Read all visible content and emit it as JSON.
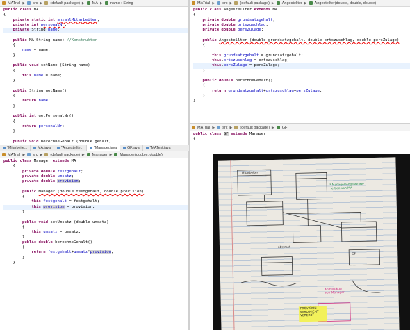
{
  "editor_top_left": {
    "breadcrumb": [
      "MATrial",
      "src",
      "(default package)",
      "MA",
      "name : String"
    ],
    "lines": [
      [
        {
          "t": "public class MA",
          "c": "kwline"
        }
      ],
      [
        {
          "t": "{",
          "c": ""
        }
      ],
      [
        {
          "t": "    "
        },
        {
          "t": "private static int",
          "c": "kw"
        },
        {
          "t": " "
        },
        {
          "t": "anzahlMitarbeiter",
          "c": "fld err"
        },
        {
          "t": ";"
        }
      ],
      [
        {
          "t": "    "
        },
        {
          "t": "private int",
          "c": "kw"
        },
        {
          "t": " "
        },
        {
          "t": "personalNr",
          "c": "fld err"
        },
        {
          "t": ";"
        }
      ],
      [
        {
          "t": "    "
        },
        {
          "t": "private",
          "c": "kw"
        },
        {
          "t": " String "
        },
        {
          "t": "name",
          "c": "fld"
        },
        {
          "t": ";"
        }
      ],
      [
        {
          "t": ""
        }
      ],
      [
        {
          "t": "    "
        },
        {
          "t": "public",
          "c": "kw"
        },
        {
          "t": " MA(String name) "
        },
        {
          "t": "//Konstruktor",
          "c": "cm"
        }
      ],
      [
        {
          "t": "    {"
        }
      ],
      [
        {
          "t": "        "
        },
        {
          "t": "name",
          "c": "fld"
        },
        {
          "t": " = name;"
        }
      ],
      [
        {
          "t": "    }"
        }
      ],
      [
        {
          "t": ""
        }
      ],
      [
        {
          "t": "    "
        },
        {
          "t": "public void",
          "c": "kw"
        },
        {
          "t": " setName (String name)"
        }
      ],
      [
        {
          "t": "    {"
        }
      ],
      [
        {
          "t": "        "
        },
        {
          "t": "this",
          "c": "kw"
        },
        {
          "t": "."
        },
        {
          "t": "name",
          "c": "fld"
        },
        {
          "t": " = name;"
        }
      ],
      [
        {
          "t": "    }"
        }
      ],
      [
        {
          "t": ""
        }
      ],
      [
        {
          "t": "    "
        },
        {
          "t": "public",
          "c": "kw"
        },
        {
          "t": " String getName()"
        }
      ],
      [
        {
          "t": "    {"
        }
      ],
      [
        {
          "t": "        "
        },
        {
          "t": "return",
          "c": "kw"
        },
        {
          "t": " "
        },
        {
          "t": "name",
          "c": "fld"
        },
        {
          "t": ";"
        }
      ],
      [
        {
          "t": "    }"
        }
      ],
      [
        {
          "t": ""
        }
      ],
      [
        {
          "t": "    "
        },
        {
          "t": "public int",
          "c": "kw"
        },
        {
          "t": " getPersonalNr()"
        }
      ],
      [
        {
          "t": "    {"
        }
      ],
      [
        {
          "t": "        "
        },
        {
          "t": "return",
          "c": "kw"
        },
        {
          "t": " "
        },
        {
          "t": "personalNr",
          "c": "fld"
        },
        {
          "t": ";"
        }
      ],
      [
        {
          "t": "    }"
        }
      ],
      [
        {
          "t": ""
        }
      ],
      [
        {
          "t": "    "
        },
        {
          "t": "public void",
          "c": "kw"
        },
        {
          "t": " berechneGehalt (double gehalt)"
        }
      ]
    ]
  },
  "editor_top_right": {
    "breadcrumb": [
      "MATrial",
      "src",
      "(default package)",
      "Angestellter",
      "Angestellter(double, double, double)"
    ],
    "lines": [
      [
        {
          "t": "public class",
          "c": "kw"
        },
        {
          "t": " Angestellter "
        },
        {
          "t": "extends",
          "c": "kw"
        },
        {
          "t": " MA"
        }
      ],
      [
        {
          "t": "{"
        }
      ],
      [
        {
          "t": "    "
        },
        {
          "t": "private double",
          "c": "kw"
        },
        {
          "t": " "
        },
        {
          "t": "grundsatzgehalt",
          "c": "fld"
        },
        {
          "t": ";"
        }
      ],
      [
        {
          "t": "    "
        },
        {
          "t": "private double",
          "c": "kw"
        },
        {
          "t": " "
        },
        {
          "t": "ortszuschlag",
          "c": "fld"
        },
        {
          "t": ";"
        }
      ],
      [
        {
          "t": "    "
        },
        {
          "t": "private double",
          "c": "kw"
        },
        {
          "t": " "
        },
        {
          "t": "persZulage",
          "c": "fld"
        },
        {
          "t": ";"
        }
      ],
      [
        {
          "t": ""
        }
      ],
      [
        {
          "t": "    "
        },
        {
          "t": "public",
          "c": "kw"
        },
        {
          "t": " "
        },
        {
          "t": "Angestellter (double grundsatzgehalt, double ortszuschlag, double persZulage)",
          "c": "err"
        }
      ],
      [
        {
          "t": "    {"
        }
      ],
      [
        {
          "t": ""
        }
      ],
      [
        {
          "t": "        "
        },
        {
          "t": "this",
          "c": "kw"
        },
        {
          "t": "."
        },
        {
          "t": "grundsatzgehalt",
          "c": "fld"
        },
        {
          "t": " = grundsatzgehalt;"
        }
      ],
      [
        {
          "t": "        "
        },
        {
          "t": "this",
          "c": "kw"
        },
        {
          "t": "."
        },
        {
          "t": "ortszuschlag",
          "c": "fld"
        },
        {
          "t": " = ortszuschlag;"
        }
      ],
      [
        {
          "t": "        "
        },
        {
          "t": "this",
          "c": "kw"
        },
        {
          "t": "."
        },
        {
          "t": "persZulage",
          "c": "fld"
        },
        {
          "t": " = persZulage;"
        }
      ],
      [
        {
          "t": "    }"
        }
      ],
      [
        {
          "t": ""
        }
      ],
      [
        {
          "t": "    "
        },
        {
          "t": "public double",
          "c": "kw"
        },
        {
          "t": " berechneGehalt()"
        }
      ],
      [
        {
          "t": "    {"
        }
      ],
      [
        {
          "t": "        "
        },
        {
          "t": "return",
          "c": "kw"
        },
        {
          "t": " "
        },
        {
          "t": "grundsatzgehalt",
          "c": "fld"
        },
        {
          "t": "+"
        },
        {
          "t": "ortszuschlag",
          "c": "fld"
        },
        {
          "t": "+"
        },
        {
          "t": "persZulage",
          "c": "fld"
        },
        {
          "t": ";"
        }
      ],
      [
        {
          "t": "    }"
        }
      ],
      [
        {
          "t": "}"
        }
      ]
    ]
  },
  "editor_gf": {
    "breadcrumb": [
      "MATrial",
      "src",
      "(default package)",
      "GF"
    ],
    "lines": [
      [
        {
          "t": "public class",
          "c": "kw"
        },
        {
          "t": " "
        },
        {
          "t": "GF",
          "c": "sel"
        },
        {
          "t": " "
        },
        {
          "t": "extends",
          "c": "kw"
        },
        {
          "t": " Manager"
        }
      ],
      [
        {
          "t": "{"
        }
      ],
      [
        {
          "t": ""
        }
      ]
    ]
  },
  "tabs": [
    "*Mitarbeite...",
    "MA.java",
    "*Angestellte...",
    "*Manager.java",
    "GF.java",
    "*MATest.java"
  ],
  "active_tab": 3,
  "editor_manager": {
    "breadcrumb": [
      "MATrial",
      "src",
      "(default package)",
      "Manager",
      "Manager(double, double)"
    ],
    "lines": [
      [
        {
          "t": "public class",
          "c": "kw"
        },
        {
          "t": " Manager "
        },
        {
          "t": "extends",
          "c": "kw"
        },
        {
          "t": " MA"
        }
      ],
      [
        {
          "t": "    {"
        }
      ],
      [
        {
          "t": "        "
        },
        {
          "t": "private double",
          "c": "kw"
        },
        {
          "t": " "
        },
        {
          "t": "festgehalt",
          "c": "fld"
        },
        {
          "t": ";"
        }
      ],
      [
        {
          "t": "        "
        },
        {
          "t": "private double",
          "c": "kw"
        },
        {
          "t": " "
        },
        {
          "t": "umsatz",
          "c": "fld"
        },
        {
          "t": ";"
        }
      ],
      [
        {
          "t": "        "
        },
        {
          "t": "private double",
          "c": "kw"
        },
        {
          "t": " "
        },
        {
          "t": "provision",
          "c": "fld sel"
        },
        {
          "t": ";"
        }
      ],
      [
        {
          "t": ""
        }
      ],
      [
        {
          "t": "        "
        },
        {
          "t": "public",
          "c": "kw"
        },
        {
          "t": " "
        },
        {
          "t": "Manager (double festgehalt, double provision)",
          "c": "err"
        }
      ],
      [
        {
          "t": "        {"
        }
      ],
      [
        {
          "t": "            "
        },
        {
          "t": "this",
          "c": "kw"
        },
        {
          "t": "."
        },
        {
          "t": "festgehalt",
          "c": "fld"
        },
        {
          "t": " = festgehalt;"
        }
      ],
      [
        {
          "t": "            "
        },
        {
          "t": "this",
          "c": "kw"
        },
        {
          "t": "."
        },
        {
          "t": "provision",
          "c": "fld sel"
        },
        {
          "t": " = provision;"
        }
      ],
      [
        {
          "t": "        }"
        }
      ],
      [
        {
          "t": ""
        }
      ],
      [
        {
          "t": "        "
        },
        {
          "t": "public void",
          "c": "kw"
        },
        {
          "t": " setUmsatz (double umsatz)"
        }
      ],
      [
        {
          "t": "        {"
        }
      ],
      [
        {
          "t": "            "
        },
        {
          "t": "this",
          "c": "kw"
        },
        {
          "t": "."
        },
        {
          "t": "umsatz",
          "c": "fld"
        },
        {
          "t": " = umsatz;"
        }
      ],
      [
        {
          "t": "        }"
        }
      ],
      [
        {
          "t": "        "
        },
        {
          "t": "public double",
          "c": "kw"
        },
        {
          "t": " berechneGehalt()"
        }
      ],
      [
        {
          "t": "        {"
        }
      ],
      [
        {
          "t": "            "
        },
        {
          "t": "return",
          "c": "kw"
        },
        {
          "t": " "
        },
        {
          "t": "festgehalt",
          "c": "fld"
        },
        {
          "t": "+"
        },
        {
          "t": "umsatz",
          "c": "fld"
        },
        {
          "t": "*"
        },
        {
          "t": "provision",
          "c": "fld sel"
        },
        {
          "t": ";"
        }
      ],
      [
        {
          "t": "        }"
        }
      ],
      [
        {
          "t": "    }"
        }
      ]
    ]
  },
  "photo": {
    "notes": {
      "uml_top": "Mitarbeiter",
      "green_right": "* Manager/Angestellter\n  erben von MA",
      "abstract": "abstract",
      "gf": "GF",
      "pink_mid": "Konstruktor\nvon Manager",
      "highlight": "PROVISION\nWIRD NICHT\nVERERBT"
    }
  },
  "colors": {
    "keyword": "#7f0055",
    "field": "#0000c0",
    "comment": "#3f7f5f",
    "error": "#e00000"
  }
}
